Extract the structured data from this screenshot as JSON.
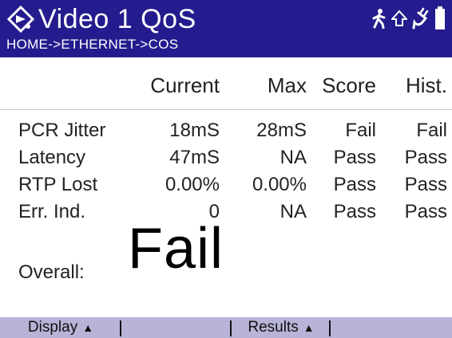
{
  "header": {
    "title": "Video 1 QoS",
    "breadcrumb": "HOME->ETHERNET->COS",
    "app_icon": "video-stream-icon",
    "status_icons": [
      "walking-person-icon",
      "up-arrow-icon",
      "power-plug-icon",
      "battery-icon"
    ]
  },
  "table": {
    "columns": [
      "Current",
      "Max",
      "Score",
      "Hist."
    ],
    "rows": [
      {
        "label": "PCR Jitter",
        "current": "18mS",
        "max": "28mS",
        "score": "Fail",
        "hist": "Fail"
      },
      {
        "label": "Latency",
        "current": "47mS",
        "max": "NA",
        "score": "Pass",
        "hist": "Pass"
      },
      {
        "label": "RTP Lost",
        "current": "0.00%",
        "max": "0.00%",
        "score": "Pass",
        "hist": "Pass"
      },
      {
        "label": "Err. Ind.",
        "current": "0",
        "max": "NA",
        "score": "Pass",
        "hist": "Pass"
      }
    ]
  },
  "overall": {
    "label": "Overall:",
    "value": "Fail"
  },
  "softkeys": [
    {
      "label": "Display",
      "arrow": "▲"
    },
    {
      "label": "",
      "arrow": ""
    },
    {
      "label": "Results",
      "arrow": "▲"
    },
    {
      "label": "",
      "arrow": ""
    }
  ],
  "colors": {
    "header_bg": "#241c8e",
    "softkey_bg": "#b7b4d8"
  }
}
